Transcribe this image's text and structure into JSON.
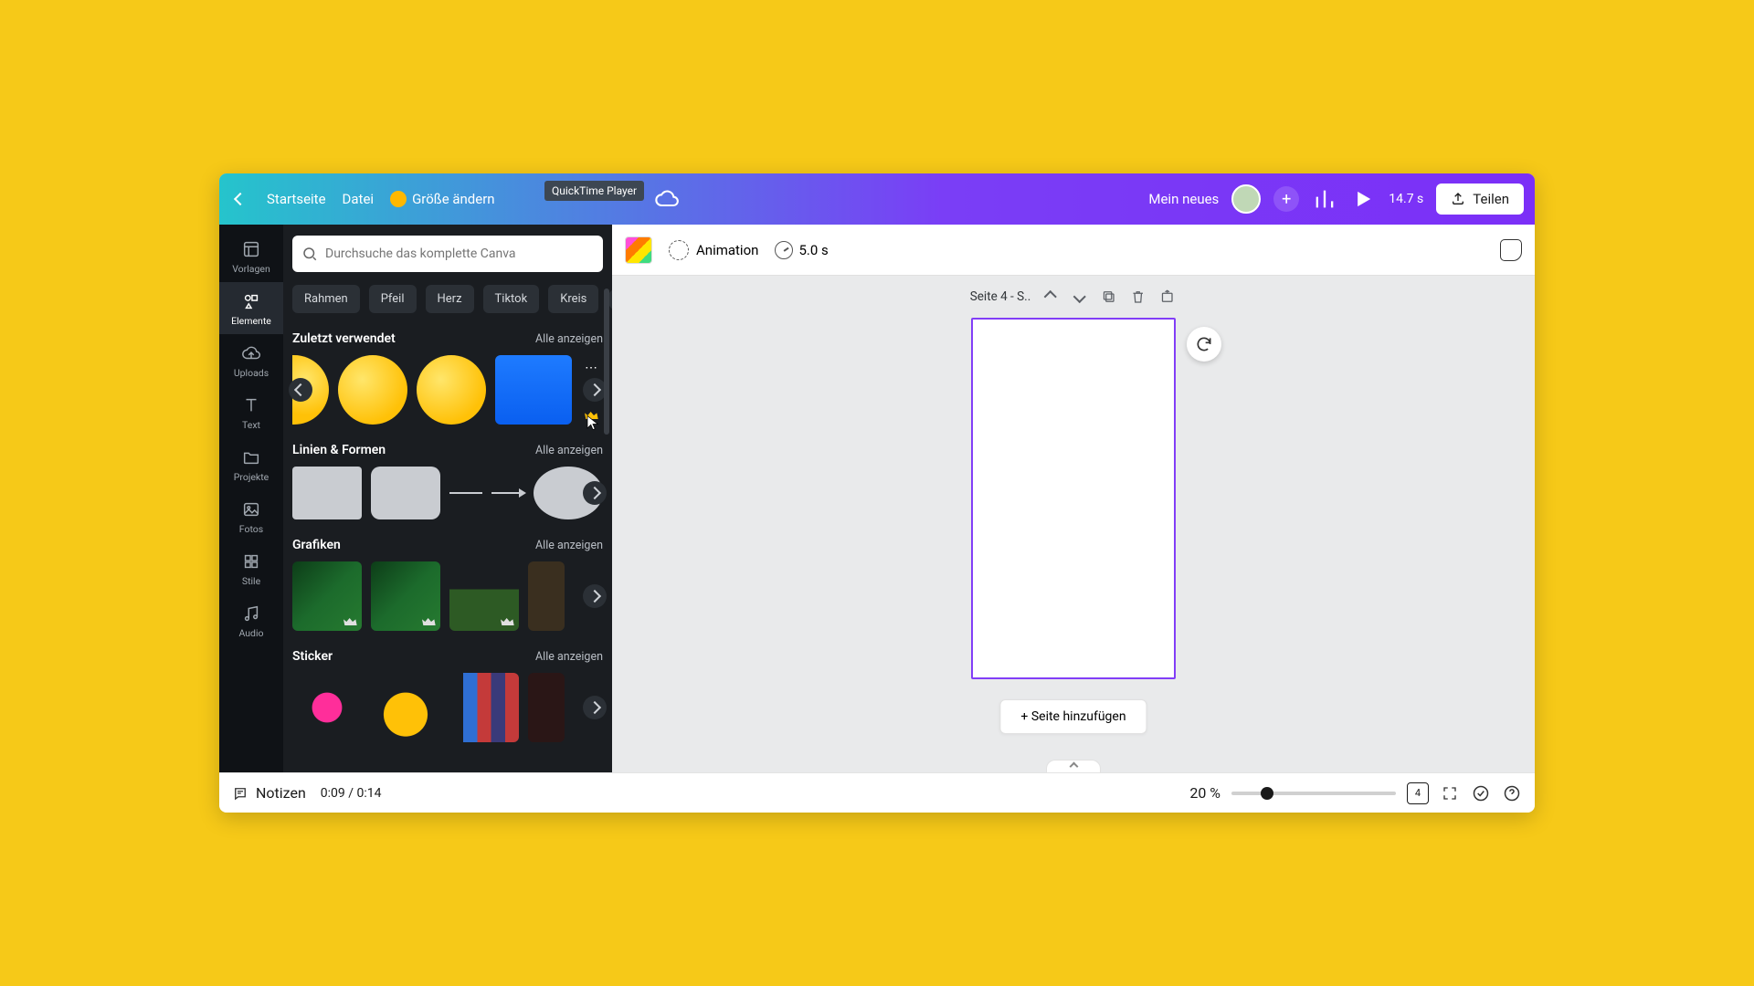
{
  "topbar": {
    "home": "Startseite",
    "file": "Datei",
    "resize": "Größe ändern",
    "tooltip": "QuickTime Player",
    "project_name": "Mein neues",
    "total_duration": "14.7 s",
    "share": "Teilen"
  },
  "rail": {
    "templates": "Vorlagen",
    "elements": "Elemente",
    "uploads": "Uploads",
    "text": "Text",
    "projects": "Projekte",
    "photos": "Fotos",
    "styles": "Stile",
    "audio": "Audio"
  },
  "panel": {
    "search_placeholder": "Durchsuche das komplette Canva",
    "chips": {
      "rahmen": "Rahmen",
      "pfeil": "Pfeil",
      "herz": "Herz",
      "tiktok": "Tiktok",
      "kreis": "Kreis"
    },
    "recent": {
      "title": "Zuletzt verwendet",
      "all": "Alle anzeigen"
    },
    "lines": {
      "title": "Linien & Formen",
      "all": "Alle anzeigen"
    },
    "graphics": {
      "title": "Grafiken",
      "all": "Alle anzeigen"
    },
    "sticker": {
      "title": "Sticker",
      "all": "Alle anzeigen"
    }
  },
  "canvas": {
    "animation": "Animation",
    "page_duration": "5.0 s",
    "page_label": "Seite 4 - S..",
    "add_page": "+ Seite hinzufügen"
  },
  "footer": {
    "notes": "Notizen",
    "playtime": "0:09 / 0:14",
    "zoom": "20 %",
    "page_count": "4"
  },
  "colors": {
    "accent": "#823ef7"
  }
}
